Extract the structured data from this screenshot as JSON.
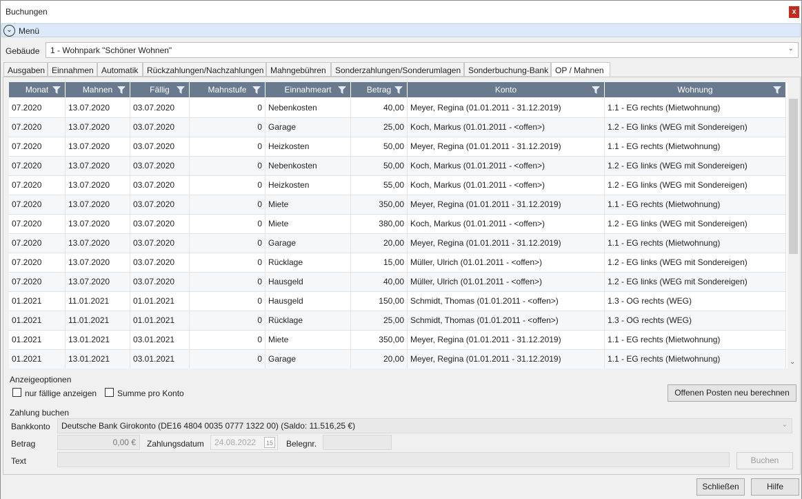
{
  "window": {
    "title": "Buchungen",
    "close_label": "x"
  },
  "menu": {
    "label": "Menü"
  },
  "gebaeude": {
    "label": "Gebäude",
    "value": "1 - Wohnpark \"Schöner Wohnen\""
  },
  "tabs": [
    {
      "label": "Ausgaben"
    },
    {
      "label": "Einnahmen"
    },
    {
      "label": "Automatik"
    },
    {
      "label": "Rückzahlungen/Nachzahlungen"
    },
    {
      "label": "Mahngebühren"
    },
    {
      "label": "Sonderzahlungen/Sonderumlagen"
    },
    {
      "label": "Sonderbuchung-Bank"
    },
    {
      "label": "OP / Mahnen"
    }
  ],
  "active_tab": "OP / Mahnen",
  "grid": {
    "columns": [
      "Monat",
      "Mahnen",
      "Fällig",
      "Mahnstufe",
      "Einnahmeart",
      "Betrag",
      "Konto",
      "Wohnung"
    ],
    "rows": [
      [
        "07.2020",
        "13.07.2020",
        "03.07.2020",
        "0",
        "Nebenkosten",
        "40,00",
        "Meyer, Regina (01.01.2011 - 31.12.2019)",
        "1.1 - EG rechts (Mietwohnung)"
      ],
      [
        "07.2020",
        "13.07.2020",
        "03.07.2020",
        "0",
        "Garage",
        "25,00",
        "Koch, Markus (01.01.2011 - <offen>)",
        "1.2 - EG links (WEG mit Sondereigen)"
      ],
      [
        "07.2020",
        "13.07.2020",
        "03.07.2020",
        "0",
        "Heizkosten",
        "50,00",
        "Meyer, Regina (01.01.2011 - 31.12.2019)",
        "1.1 - EG rechts (Mietwohnung)"
      ],
      [
        "07.2020",
        "13.07.2020",
        "03.07.2020",
        "0",
        "Nebenkosten",
        "50,00",
        "Koch, Markus (01.01.2011 - <offen>)",
        "1.2 - EG links (WEG mit Sondereigen)"
      ],
      [
        "07.2020",
        "13.07.2020",
        "03.07.2020",
        "0",
        "Heizkosten",
        "55,00",
        "Koch, Markus (01.01.2011 - <offen>)",
        "1.2 - EG links (WEG mit Sondereigen)"
      ],
      [
        "07.2020",
        "13.07.2020",
        "03.07.2020",
        "0",
        "Miete",
        "350,00",
        "Meyer, Regina (01.01.2011 - 31.12.2019)",
        "1.1 - EG rechts (Mietwohnung)"
      ],
      [
        "07.2020",
        "13.07.2020",
        "03.07.2020",
        "0",
        "Miete",
        "380,00",
        "Koch, Markus (01.01.2011 - <offen>)",
        "1.2 - EG links (WEG mit Sondereigen)"
      ],
      [
        "07.2020",
        "13.07.2020",
        "03.07.2020",
        "0",
        "Garage",
        "20,00",
        "Meyer, Regina (01.01.2011 - 31.12.2019)",
        "1.1 - EG rechts (Mietwohnung)"
      ],
      [
        "07.2020",
        "13.07.2020",
        "03.07.2020",
        "0",
        "Rücklage",
        "15,00",
        "Müller, Ulrich (01.01.2011 - <offen>)",
        "1.2 - EG links (WEG mit Sondereigen)"
      ],
      [
        "07.2020",
        "13.07.2020",
        "03.07.2020",
        "0",
        "Hausgeld",
        "40,00",
        "Müller, Ulrich (01.01.2011 - <offen>)",
        "1.2 - EG links (WEG mit Sondereigen)"
      ],
      [
        "01.2021",
        "11.01.2021",
        "01.01.2021",
        "0",
        "Hausgeld",
        "150,00",
        "Schmidt, Thomas (01.01.2011 - <offen>)",
        "1.3 - OG rechts (WEG)"
      ],
      [
        "01.2021",
        "11.01.2021",
        "01.01.2021",
        "0",
        "Rücklage",
        "25,00",
        "Schmidt, Thomas (01.01.2011 - <offen>)",
        "1.3 - OG rechts (WEG)"
      ],
      [
        "01.2021",
        "13.01.2021",
        "03.01.2021",
        "0",
        "Miete",
        "350,00",
        "Meyer, Regina (01.01.2011 - 31.12.2019)",
        "1.1 - EG rechts (Mietwohnung)"
      ],
      [
        "01.2021",
        "13.01.2021",
        "03.01.2021",
        "0",
        "Garage",
        "20,00",
        "Meyer, Regina (01.01.2011 - 31.12.2019)",
        "1.1 - EG rechts (Mietwohnung)"
      ]
    ]
  },
  "anzeige": {
    "title": "Anzeigeoptionen",
    "faellig_label": "nur fällige anzeigen",
    "summe_label": "Summe pro Konto",
    "recalc_label": "Offenen Posten neu berechnen"
  },
  "zahlung": {
    "title": "Zahlung buchen",
    "bankkonto_label": "Bankkonto",
    "bankkonto_value": "Deutsche Bank Girokonto (DE16 4804 0035 0777 1322 00) (Saldo: 11.516,25 €)",
    "betrag_label": "Betrag",
    "betrag_value": "0,00 €",
    "datum_label": "Zahlungsdatum",
    "datum_value": "24.08.2022",
    "calendar_day": "15",
    "beleg_label": "Belegnr.",
    "beleg_value": "",
    "text_label": "Text",
    "text_value": "",
    "buchen_label": "Buchen"
  },
  "footer": {
    "close_label": "Schließen",
    "help_label": "Hilfe"
  },
  "colors": {
    "header_bg": "#6a7a8e",
    "menu_bg": "#dce9f8",
    "close_bg": "#c42b1c"
  }
}
